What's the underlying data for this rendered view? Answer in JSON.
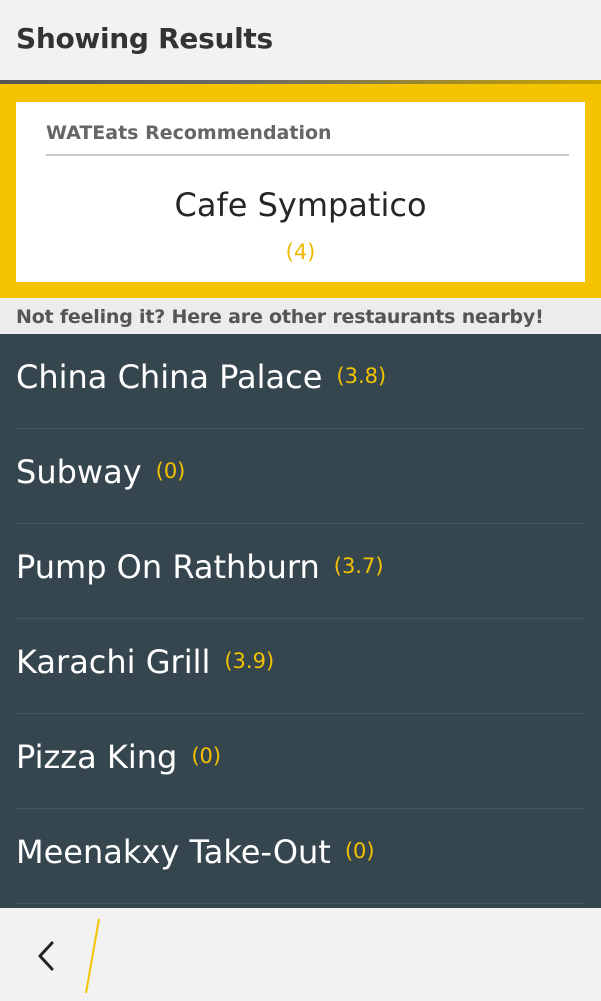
{
  "header": {
    "title": "Showing Results"
  },
  "recommendation": {
    "heading": "WATEats Recommendation",
    "name": "Cafe Sympatico",
    "rating": "(4)"
  },
  "nearby": {
    "label": "Not feeling it? Here are other restaurants nearby!",
    "items": [
      {
        "name": "China China Palace",
        "rating": "(3.8)"
      },
      {
        "name": "Subway",
        "rating": "(0)"
      },
      {
        "name": "Pump On Rathburn",
        "rating": "(3.7)"
      },
      {
        "name": "Karachi Grill",
        "rating": "(3.9)"
      },
      {
        "name": "Pizza King",
        "rating": "(0)"
      },
      {
        "name": "Meenakxy Take-Out",
        "rating": "(0)"
      }
    ]
  },
  "footer": {
    "back_icon": "chevron-left-icon"
  },
  "colors": {
    "accent": "#f5c400",
    "list_background": "#36464f",
    "rating_text": "#f2c200"
  }
}
